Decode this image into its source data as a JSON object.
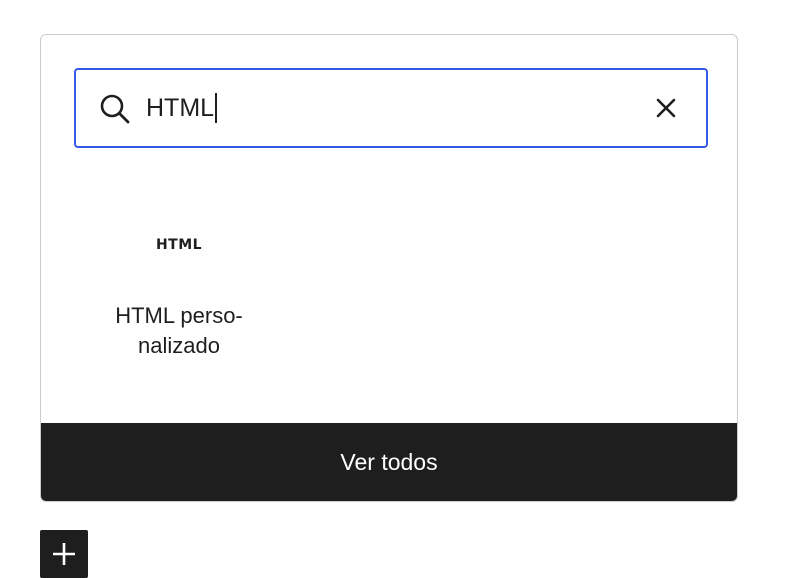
{
  "search": {
    "value": "HTML",
    "search_icon": "search-icon",
    "clear_icon": "close-icon",
    "accent_color": "#3858e9"
  },
  "results": [
    {
      "icon_text": "HTML",
      "label_line1": "HTML perso-",
      "label_line2": "nalizado"
    }
  ],
  "footer": {
    "label": "Ver todos",
    "background": "#1e1e1e"
  },
  "add_block": {
    "icon": "plus-icon"
  }
}
